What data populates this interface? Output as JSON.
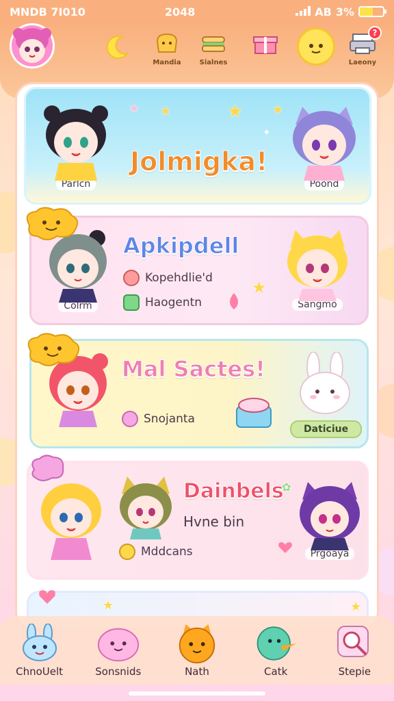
{
  "status_bar": {
    "time": "MNDB 7I010",
    "center": "2048",
    "network": "AB",
    "battery_text": "3%",
    "battery_level": 0.55
  },
  "header": {
    "buttons": [
      {
        "label": "Mandia",
        "icon": "bread-icon"
      },
      {
        "label": "Sialnes",
        "icon": "sandwich-icon"
      },
      {
        "label": "",
        "icon": "gift-box-icon"
      },
      {
        "label": "",
        "icon": "smiley-icon"
      },
      {
        "label": "Laeony",
        "icon": "printer-icon",
        "badge": "?"
      }
    ],
    "moon_icon": "moon-icon"
  },
  "cards": {
    "welcome": {
      "title": "Jolmigka!",
      "left_name": "Parlcn",
      "right_name": "Poond"
    },
    "apk": {
      "title": "Apkipdell",
      "items": [
        {
          "text": "Kopehdlie'd",
          "icon": "circle-badge-icon"
        },
        {
          "text": "Haogentn",
          "icon": "leaf-icon"
        }
      ],
      "left_name": "Colrm",
      "right_name": "Sangmo"
    },
    "mal": {
      "title": "Mal Sactes!",
      "item": "Snojanta",
      "item_icon": "flower-icon",
      "button": "Daticiue"
    },
    "dain": {
      "title": "Dainbels",
      "subtitle": "Hvne bin",
      "item": "Mddcans",
      "item_icon": "coin-icon",
      "right_name": "Prgoaya"
    }
  },
  "bottom_nav": [
    {
      "label": "ChnoUelt",
      "icon": "bunny-icon"
    },
    {
      "label": "Sonsnids",
      "icon": "pink-blob-icon"
    },
    {
      "label": "Nath",
      "icon": "orange-cat-icon"
    },
    {
      "label": "Catk",
      "icon": "duck-icon"
    },
    {
      "label": "Stepie",
      "icon": "magnifier-icon"
    }
  ],
  "colors": {
    "accent": "#f9b07e",
    "pink": "#ff8fcf",
    "yellow": "#ffe35a",
    "green": "#a9cf73"
  }
}
